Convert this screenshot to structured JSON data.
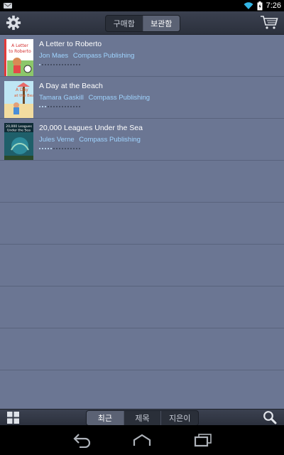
{
  "status": {
    "time": "7:26",
    "icons": [
      "notification-icon",
      "wifi-icon",
      "battery-charging-icon"
    ]
  },
  "header": {
    "tabs": [
      {
        "label": "구매함",
        "active": false
      },
      {
        "label": "보관함",
        "active": true
      }
    ],
    "icons": [
      "gear-icon",
      "cart-icon"
    ]
  },
  "books": [
    {
      "title": "A Letter to Roberto",
      "author": "Jon Maes",
      "publisher": "Compass Publishing",
      "cover_title": "A Letter to Roberto",
      "progress": 0.08
    },
    {
      "title": "A Day at the Beach",
      "author": "Tamara Gaskill",
      "publisher": "Compass Publishing",
      "cover_title": "A Day at the Beach",
      "progress": 0.2
    },
    {
      "title": "20,000 Leagues Under the Sea",
      "author": "Jules Verne",
      "publisher": "Compass Publishing",
      "cover_title": "20,000 Leagues Under the Sea",
      "progress": 0.3
    }
  ],
  "footer": {
    "sort_tabs": [
      {
        "label": "최근",
        "active": true
      },
      {
        "label": "제목",
        "active": false
      },
      {
        "label": "지은이",
        "active": false
      }
    ],
    "icons": [
      "grid-view-icon",
      "search-icon"
    ]
  },
  "navbar": {
    "icons": [
      "back-icon",
      "home-icon",
      "recents-icon"
    ]
  },
  "colors": {
    "list_bg": "#6b7693",
    "meta_text": "#9fd4ff",
    "bar_bg": "#343946"
  }
}
